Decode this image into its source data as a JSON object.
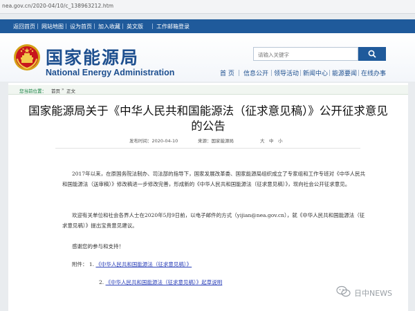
{
  "browser": {
    "url": "nea.gov.cn/2020-04/10/c_138963212.htm"
  },
  "topnav": {
    "items": [
      "返回首页",
      "网站地图",
      "设为首页",
      "加入收藏",
      "英文版",
      "工作邮箱登录"
    ]
  },
  "header": {
    "brand_cn": "国家能源局",
    "brand_en": "National Energy Administration",
    "emblem_icon": "national-emblem",
    "search_placeholder": "请输入关键字",
    "search_icon": "search-icon",
    "accent_color": "#1f5a9b",
    "nav": [
      "首 页",
      "信息公开",
      "领导活动",
      "新闻中心",
      "能源要闻",
      "在线办事"
    ]
  },
  "breadcrumb": {
    "label": "您当前位置：",
    "items": [
      "首页",
      "正文"
    ],
    "separator": "»"
  },
  "article": {
    "title_line1": "国家能源局关于《中华人民共和国能源法（征求意见稿）》公开征求意见",
    "title_line2": "的公告",
    "date_label": "发布时间：2020-04-10",
    "source_label": "来源：国家能源局",
    "font_sizes": [
      "大",
      "中",
      "小"
    ],
    "paragraphs": [
      "2017年以来，在原国务院法制办、司法部的指导下，国家发展改革委、国家能源局组织成立了专家组和工作专班对《中华人民共和国能源法（送审稿）》修改稿进一步修改完善，形成新的《中华人民共和国能源法（征求意见稿）》，现向社会公开征求意见。",
      "欢迎有关单位和社会各界人士在2020年5月9日前，以电子邮件的方式（yijian@nea.gov.cn），就《中华人民共和国能源法（征求意见稿）》提出宝贵意见建议。",
      "感谢您的参与和支持！"
    ],
    "attachments_label": "附件：",
    "attachments": [
      {
        "num": "1.",
        "text": "《中华人民共和国能源法（征求意见稿）》"
      },
      {
        "num": "2.",
        "text": "《中华人民共和国能源法（征求意见稿）》起草说明"
      }
    ]
  },
  "watermark": {
    "text": "日中NEWS"
  }
}
